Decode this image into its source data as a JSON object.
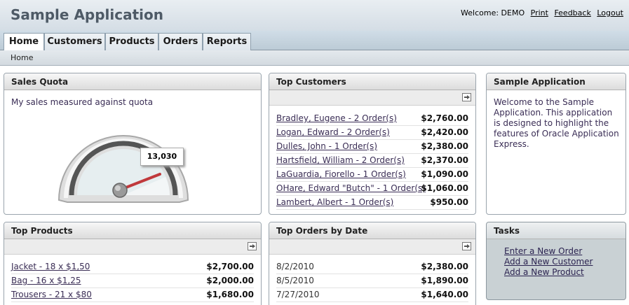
{
  "header": {
    "app_title": "Sample Application",
    "welcome": "Welcome: DEMO",
    "links": {
      "print": "Print",
      "feedback": "Feedback",
      "logout": "Logout"
    }
  },
  "tabs": [
    {
      "label": "Home",
      "active": true
    },
    {
      "label": "Customers"
    },
    {
      "label": "Products"
    },
    {
      "label": "Orders"
    },
    {
      "label": "Reports"
    }
  ],
  "breadcrumb": "Home",
  "sales_quota": {
    "title": "Sales Quota",
    "text": "My sales measured against quota",
    "gauge_value": "13,030"
  },
  "top_customers": {
    "title": "Top Customers",
    "rows": [
      {
        "name": "Bradley, Eugene - 2 Order(s)",
        "amount": "$2,760.00"
      },
      {
        "name": "Logan, Edward - 2 Order(s)",
        "amount": "$2,420.00"
      },
      {
        "name": "Dulles, John - 1 Order(s)",
        "amount": "$2,380.00"
      },
      {
        "name": "Hartsfield, William - 2 Order(s)",
        "amount": "$2,370.00"
      },
      {
        "name": "LaGuardia, Fiorello - 1 Order(s)",
        "amount": "$1,090.00"
      },
      {
        "name": "OHare, Edward \"Butch\" - 1 Order(s)",
        "amount": "$1,060.00"
      },
      {
        "name": "Lambert, Albert - 1 Order(s)",
        "amount": "$950.00"
      }
    ]
  },
  "sample_app": {
    "title": "Sample Application",
    "text": "Welcome to the Sample Application. This application is designed to highlight the features of Oracle Application Express."
  },
  "top_products": {
    "title": "Top Products",
    "rows": [
      {
        "name": "Jacket - 18 x $1,50",
        "amount": "$2,700.00"
      },
      {
        "name": "Bag - 16 x $1,25",
        "amount": "$2,000.00"
      },
      {
        "name": "Trousers - 21 x $80",
        "amount": "$1,680.00"
      }
    ]
  },
  "top_orders": {
    "title": "Top Orders by Date",
    "rows": [
      {
        "date": "8/2/2010",
        "amount": "$2,380.00"
      },
      {
        "date": "8/5/2010",
        "amount": "$1,890.00"
      },
      {
        "date": "7/27/2010",
        "amount": "$1,640.00"
      }
    ]
  },
  "tasks": {
    "title": "Tasks",
    "links": [
      "Enter a New Order",
      "Add a New Customer",
      "Add a New Product"
    ]
  }
}
